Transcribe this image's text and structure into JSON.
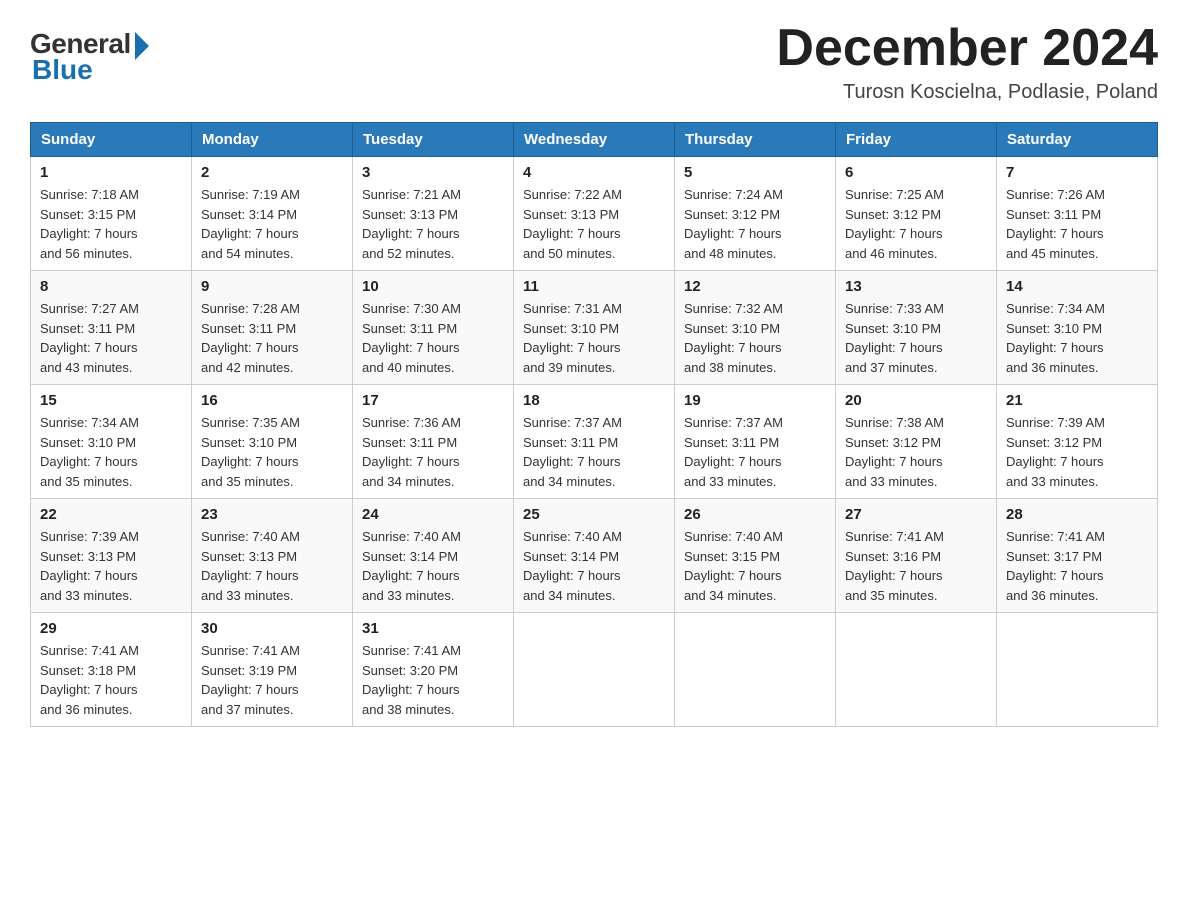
{
  "logo": {
    "general": "General",
    "blue": "Blue"
  },
  "header": {
    "title": "December 2024",
    "subtitle": "Turosn Koscielna, Podlasie, Poland"
  },
  "days_of_week": [
    "Sunday",
    "Monday",
    "Tuesday",
    "Wednesday",
    "Thursday",
    "Friday",
    "Saturday"
  ],
  "weeks": [
    [
      {
        "day": "1",
        "sunrise": "7:18 AM",
        "sunset": "3:15 PM",
        "daylight": "7 hours and 56 minutes."
      },
      {
        "day": "2",
        "sunrise": "7:19 AM",
        "sunset": "3:14 PM",
        "daylight": "7 hours and 54 minutes."
      },
      {
        "day": "3",
        "sunrise": "7:21 AM",
        "sunset": "3:13 PM",
        "daylight": "7 hours and 52 minutes."
      },
      {
        "day": "4",
        "sunrise": "7:22 AM",
        "sunset": "3:13 PM",
        "daylight": "7 hours and 50 minutes."
      },
      {
        "day": "5",
        "sunrise": "7:24 AM",
        "sunset": "3:12 PM",
        "daylight": "7 hours and 48 minutes."
      },
      {
        "day": "6",
        "sunrise": "7:25 AM",
        "sunset": "3:12 PM",
        "daylight": "7 hours and 46 minutes."
      },
      {
        "day": "7",
        "sunrise": "7:26 AM",
        "sunset": "3:11 PM",
        "daylight": "7 hours and 45 minutes."
      }
    ],
    [
      {
        "day": "8",
        "sunrise": "7:27 AM",
        "sunset": "3:11 PM",
        "daylight": "7 hours and 43 minutes."
      },
      {
        "day": "9",
        "sunrise": "7:28 AM",
        "sunset": "3:11 PM",
        "daylight": "7 hours and 42 minutes."
      },
      {
        "day": "10",
        "sunrise": "7:30 AM",
        "sunset": "3:11 PM",
        "daylight": "7 hours and 40 minutes."
      },
      {
        "day": "11",
        "sunrise": "7:31 AM",
        "sunset": "3:10 PM",
        "daylight": "7 hours and 39 minutes."
      },
      {
        "day": "12",
        "sunrise": "7:32 AM",
        "sunset": "3:10 PM",
        "daylight": "7 hours and 38 minutes."
      },
      {
        "day": "13",
        "sunrise": "7:33 AM",
        "sunset": "3:10 PM",
        "daylight": "7 hours and 37 minutes."
      },
      {
        "day": "14",
        "sunrise": "7:34 AM",
        "sunset": "3:10 PM",
        "daylight": "7 hours and 36 minutes."
      }
    ],
    [
      {
        "day": "15",
        "sunrise": "7:34 AM",
        "sunset": "3:10 PM",
        "daylight": "7 hours and 35 minutes."
      },
      {
        "day": "16",
        "sunrise": "7:35 AM",
        "sunset": "3:10 PM",
        "daylight": "7 hours and 35 minutes."
      },
      {
        "day": "17",
        "sunrise": "7:36 AM",
        "sunset": "3:11 PM",
        "daylight": "7 hours and 34 minutes."
      },
      {
        "day": "18",
        "sunrise": "7:37 AM",
        "sunset": "3:11 PM",
        "daylight": "7 hours and 34 minutes."
      },
      {
        "day": "19",
        "sunrise": "7:37 AM",
        "sunset": "3:11 PM",
        "daylight": "7 hours and 33 minutes."
      },
      {
        "day": "20",
        "sunrise": "7:38 AM",
        "sunset": "3:12 PM",
        "daylight": "7 hours and 33 minutes."
      },
      {
        "day": "21",
        "sunrise": "7:39 AM",
        "sunset": "3:12 PM",
        "daylight": "7 hours and 33 minutes."
      }
    ],
    [
      {
        "day": "22",
        "sunrise": "7:39 AM",
        "sunset": "3:13 PM",
        "daylight": "7 hours and 33 minutes."
      },
      {
        "day": "23",
        "sunrise": "7:40 AM",
        "sunset": "3:13 PM",
        "daylight": "7 hours and 33 minutes."
      },
      {
        "day": "24",
        "sunrise": "7:40 AM",
        "sunset": "3:14 PM",
        "daylight": "7 hours and 33 minutes."
      },
      {
        "day": "25",
        "sunrise": "7:40 AM",
        "sunset": "3:14 PM",
        "daylight": "7 hours and 34 minutes."
      },
      {
        "day": "26",
        "sunrise": "7:40 AM",
        "sunset": "3:15 PM",
        "daylight": "7 hours and 34 minutes."
      },
      {
        "day": "27",
        "sunrise": "7:41 AM",
        "sunset": "3:16 PM",
        "daylight": "7 hours and 35 minutes."
      },
      {
        "day": "28",
        "sunrise": "7:41 AM",
        "sunset": "3:17 PM",
        "daylight": "7 hours and 36 minutes."
      }
    ],
    [
      {
        "day": "29",
        "sunrise": "7:41 AM",
        "sunset": "3:18 PM",
        "daylight": "7 hours and 36 minutes."
      },
      {
        "day": "30",
        "sunrise": "7:41 AM",
        "sunset": "3:19 PM",
        "daylight": "7 hours and 37 minutes."
      },
      {
        "day": "31",
        "sunrise": "7:41 AM",
        "sunset": "3:20 PM",
        "daylight": "7 hours and 38 minutes."
      },
      null,
      null,
      null,
      null
    ]
  ],
  "labels": {
    "sunrise": "Sunrise:",
    "sunset": "Sunset:",
    "daylight": "Daylight:"
  }
}
